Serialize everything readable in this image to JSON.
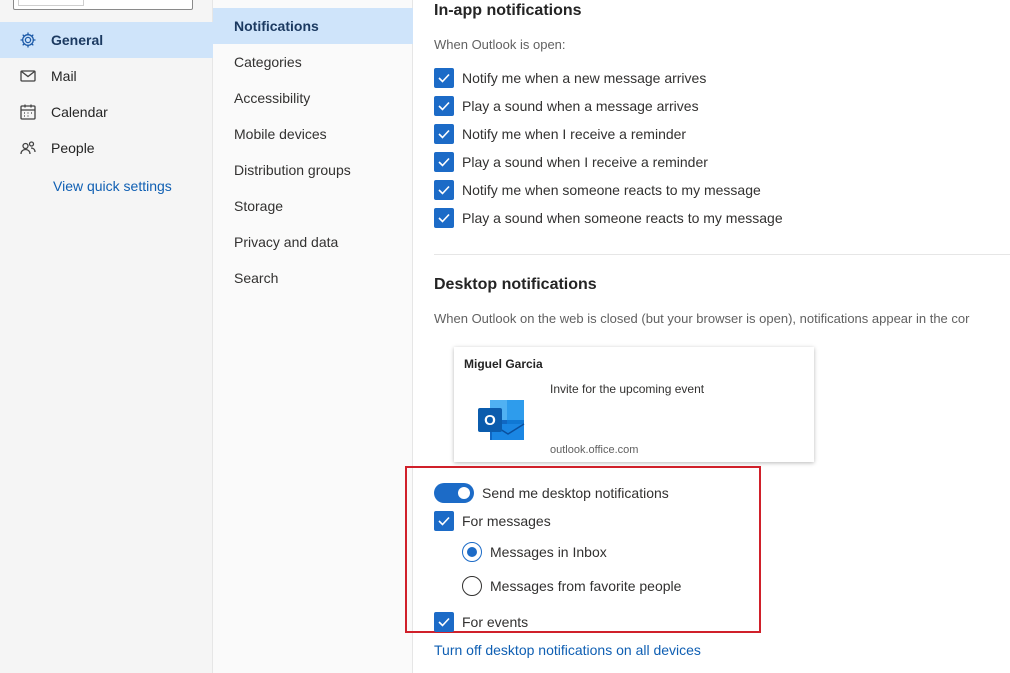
{
  "leftnav": {
    "items": [
      {
        "label": "General",
        "icon": "gear-icon"
      },
      {
        "label": "Mail",
        "icon": "mail-icon"
      },
      {
        "label": "Calendar",
        "icon": "calendar-icon"
      },
      {
        "label": "People",
        "icon": "people-icon"
      }
    ],
    "quick_settings": "View quick settings"
  },
  "subnav": {
    "items": [
      "Notifications",
      "Categories",
      "Accessibility",
      "Mobile devices",
      "Distribution groups",
      "Storage",
      "Privacy and data",
      "Search"
    ]
  },
  "inapp": {
    "title": "In-app notifications",
    "subtitle": "When Outlook is open:",
    "options": [
      "Notify me when a new message arrives",
      "Play a sound when a message arrives",
      "Notify me when I receive a reminder",
      "Play a sound when I receive a reminder",
      "Notify me when someone reacts to my message",
      "Play a sound when someone reacts to my message"
    ]
  },
  "desktop": {
    "title": "Desktop notifications",
    "subtitle": "When Outlook on the web is closed (but your browser is open), notifications appear in the cor",
    "preview": {
      "sender": "Miguel Garcia",
      "subject": "Invite for the upcoming event",
      "domain": "outlook.office.com",
      "logo_letter": "O"
    },
    "toggle_label": "Send me desktop notifications",
    "for_messages": "For messages",
    "radio_inbox": "Messages in Inbox",
    "radio_favorites": "Messages from favorite people",
    "for_events": "For events",
    "turn_off_link": "Turn off desktop notifications on all devices"
  },
  "colors": {
    "accent": "#1c6bc7",
    "selected_bg": "#cfe4fa",
    "highlight_border": "#d0202a",
    "link": "#0f5fb3"
  }
}
